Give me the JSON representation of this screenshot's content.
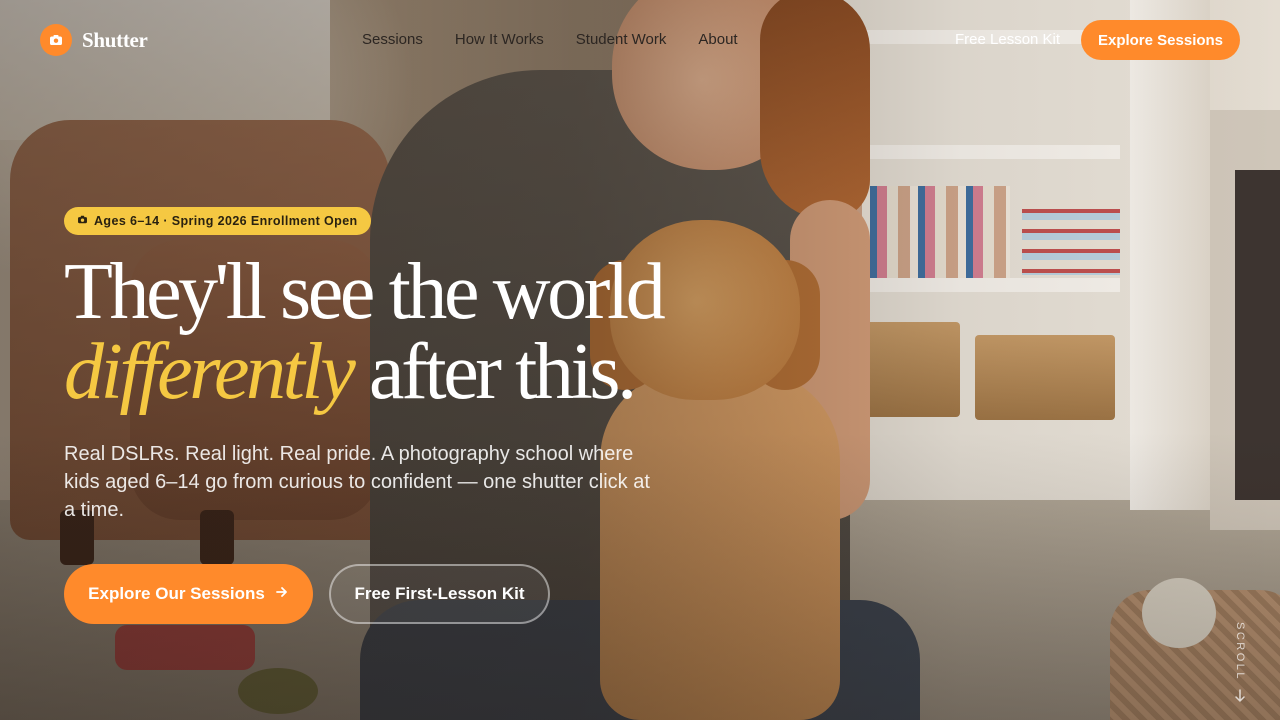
{
  "brand": {
    "name": "Shutter",
    "icon": "camera-icon",
    "accent_color": "#ff8a2b"
  },
  "nav": {
    "links": [
      {
        "label": "Sessions"
      },
      {
        "label": "How It Works"
      },
      {
        "label": "Student Work"
      },
      {
        "label": "About"
      }
    ],
    "kit_label": "Free Lesson Kit",
    "cta_label": "Explore Sessions"
  },
  "hero": {
    "badge": "Ages 6–14 · Spring 2026 Enrollment Open",
    "badge_icon": "camera-icon",
    "headline_line1": "They'll see the world",
    "headline_accent": "differently",
    "headline_line2_rest": " after this.",
    "subhead": "Real DSLRs. Real light. Real pride. A photography school where kids aged 6–14 go from curious to confident — one shutter click at a time.",
    "primary_cta": "Explore Our Sessions",
    "primary_cta_icon": "arrow-right-icon",
    "secondary_cta": "Free First-Lesson Kit",
    "accent_color": "#f5c842"
  },
  "scroll": {
    "label": "SCROLL",
    "icon": "arrow-down-icon"
  }
}
